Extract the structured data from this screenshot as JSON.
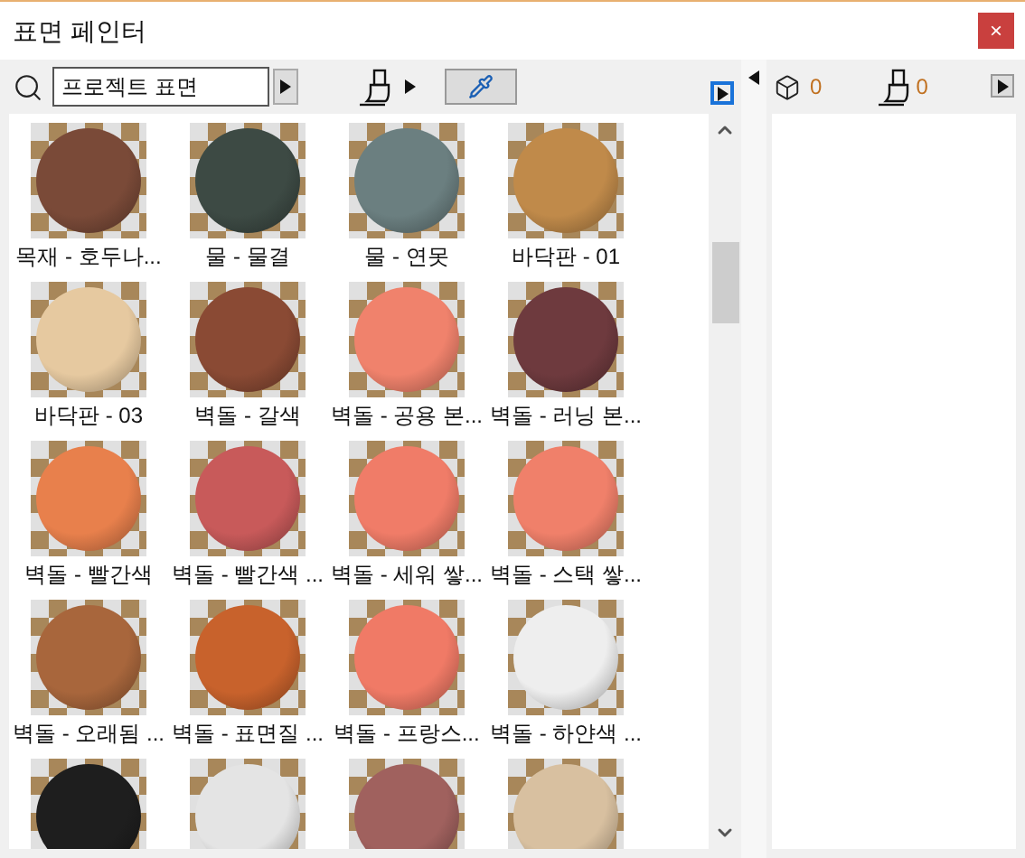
{
  "window": {
    "title": "표면 페인터",
    "close": "×"
  },
  "toolbar": {
    "search_value": "프로젝트 표면",
    "eyedropper_selected": true
  },
  "materials": [
    {
      "label": "목재 - 호두나...",
      "color": "#7a4a38"
    },
    {
      "label": "물 - 물결",
      "color": "#3d4a44"
    },
    {
      "label": "물 - 연못",
      "color": "#6b7f80"
    },
    {
      "label": "바닥판 - 01",
      "color": "#c08a4a"
    },
    {
      "label": "바닥판 - 03",
      "color": "#e6c9a0"
    },
    {
      "label": "벽돌 - 갈색",
      "color": "#8a4a34"
    },
    {
      "label": "벽돌 - 공용 본...",
      "color": "#f0826c"
    },
    {
      "label": "벽돌 - 러닝 본...",
      "color": "#6e3a3e"
    },
    {
      "label": "벽돌 - 빨간색",
      "color": "#e8804c"
    },
    {
      "label": "벽돌 - 빨간색 ...",
      "color": "#c85a5a"
    },
    {
      "label": "벽돌 - 세워 쌓...",
      "color": "#f07c68"
    },
    {
      "label": "벽돌 - 스택 쌓...",
      "color": "#f0806a"
    },
    {
      "label": "벽돌 - 오래됨 ...",
      "color": "#a8663c"
    },
    {
      "label": "벽돌 - 표면질 ...",
      "color": "#c8622c"
    },
    {
      "label": "벽돌 - 프랑스...",
      "color": "#f07a66"
    },
    {
      "label": "벽돌 - 하얀색 ...",
      "color": "#eeeeee"
    },
    {
      "color": "#1e1e1e"
    },
    {
      "color": "#e4e4e4"
    },
    {
      "color": "#a0615e"
    },
    {
      "color": "#d8c0a0"
    }
  ],
  "side": {
    "surface_count": "0",
    "paint_count": "0"
  }
}
